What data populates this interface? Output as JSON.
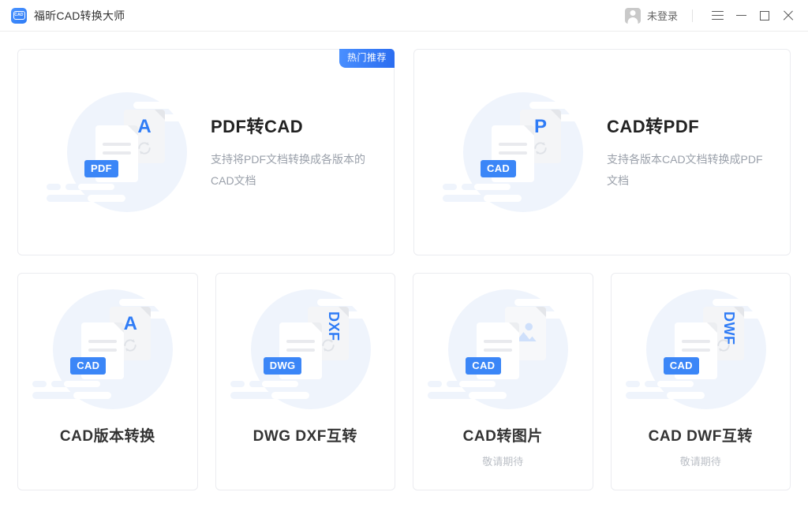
{
  "titlebar": {
    "logo_text": "CAD",
    "app_title": "福昕CAD转换大师",
    "account_label": "未登录",
    "menu_icon": "hamburger-menu-icon",
    "minimize_icon": "minimize-icon",
    "maximize_icon": "maximize-icon",
    "close_icon": "close-icon",
    "avatar_icon": "user-avatar-icon"
  },
  "colors": {
    "accent_blue": "#3b86f7",
    "badge_gradient_from": "#4a90ff",
    "badge_gradient_to": "#2a6cf0",
    "circle_bg": "#eff4fc",
    "card_border": "#ebecf0",
    "title_text": "#333333",
    "muted_text": "#9aa0aa",
    "coming_soon_text": "#bcc0c7"
  },
  "featured_badge": "热门推荐",
  "main_cards": [
    {
      "title": "PDF转CAD",
      "description": "支持将PDF文档转换成各版本的CAD文档",
      "badge_label": "PDF",
      "back_letter": "A",
      "badge": "热门推荐"
    },
    {
      "title": "CAD转PDF",
      "description": "支持各版本CAD文档转换成PDF文档",
      "badge_label": "CAD",
      "back_letter": "P"
    }
  ],
  "secondary_cards": [
    {
      "title": "CAD版本转换",
      "badge_label": "CAD",
      "back_letter": "A",
      "subtitle": ""
    },
    {
      "title": "DWG DXF互转",
      "badge_label": "DWG",
      "back_letter": "DXF",
      "subtitle": ""
    },
    {
      "title": "CAD转图片",
      "badge_label": "CAD",
      "back_letter": "",
      "subtitle": "敬请期待"
    },
    {
      "title": "CAD DWF互转",
      "badge_label": "CAD",
      "back_letter": "DWF",
      "subtitle": "敬请期待"
    }
  ]
}
